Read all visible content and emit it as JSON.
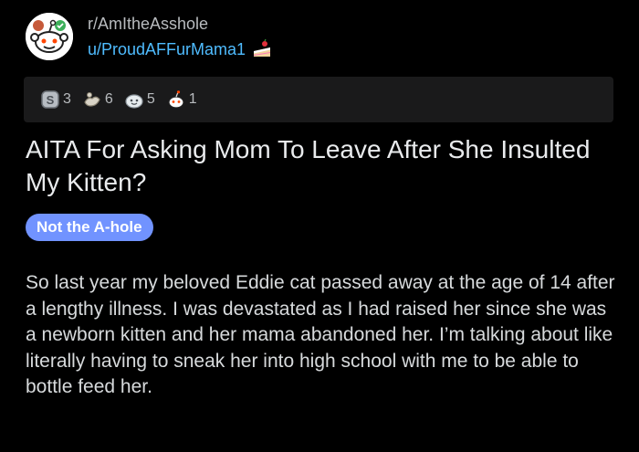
{
  "post": {
    "subreddit": "r/AmItheAsshole",
    "username": "u/ProudAFFurMama1",
    "awards": [
      {
        "icon": "silver-award-icon",
        "count": "3"
      },
      {
        "icon": "helpful-award-icon",
        "count": "6"
      },
      {
        "icon": "wholesome-award-icon",
        "count": "5"
      },
      {
        "icon": "snoo-award-icon",
        "count": "1"
      }
    ],
    "title": "AITA For Asking Mom To Leave After She Insulted My Kitten?",
    "flair": "Not the A-hole",
    "body": "So last year my beloved Eddie cat passed away at the age of 14 after a lengthy illness. I was devastated as I had raised her since she was a newborn kitten and her mama abandoned her. I’m talking about like literally having to sneak her into high school with me to be able to bottle feed her."
  },
  "colors": {
    "background": "#000000",
    "username": "#4fbcff",
    "flair_bg": "#7193ff",
    "awards_bg": "#1a1a1b"
  }
}
